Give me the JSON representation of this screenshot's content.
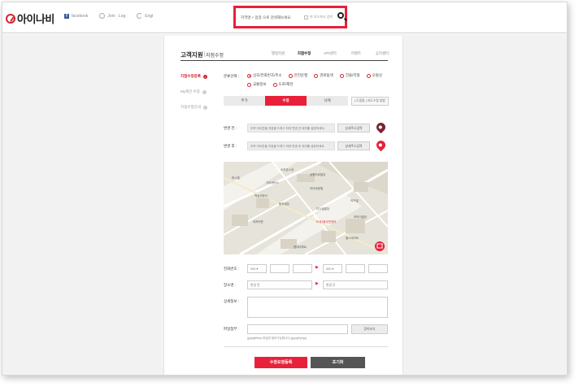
{
  "header": {
    "logo_text": "아이나비",
    "links": [
      {
        "label": "facebook"
      },
      {
        "label": "Join · Log"
      },
      {
        "label": "Engl"
      }
    ],
    "search": {
      "value": "지역명 + 업종 으로 검색해보세요",
      "option_label": "현 지도에서 검색"
    }
  },
  "page": {
    "title": "고객지원",
    "subtitle": "지점수정",
    "tabs": [
      "행정지원",
      "지점수정",
      "API센터",
      "이벤트",
      "공지센터"
    ],
    "active_tab": 1
  },
  "sidebar": {
    "items": [
      {
        "label": "지점수정등록",
        "active": true
      },
      {
        "label": "My제안 수정",
        "active": false
      },
      {
        "label": "지점수정안내",
        "active": false
      }
    ]
  },
  "form": {
    "category_label": "분류선택",
    "categories": [
      {
        "label": "상호/전화번호/주소",
        "checked": true
      },
      {
        "label": "안전운행",
        "checked": false
      },
      {
        "label": "경로탐색",
        "checked": false
      },
      {
        "label": "건물/지형",
        "checked": false
      },
      {
        "label": "오탈상",
        "checked": false
      },
      {
        "label": "교통정보",
        "checked": false
      },
      {
        "label": "도로/제한",
        "checked": false
      }
    ],
    "modes": [
      "추가",
      "수정",
      "삭제"
    ],
    "active_mode": 1,
    "mode_hint": "[ 도움말 ] 지도수정 방법",
    "before_label": "변경 전",
    "before_value": "우측 아이콘을 지정을 드래그 하여 변경 전 위치를 설정하세요.",
    "after_label": "변경 후",
    "after_value": "우측 아이콘을 지정을 드래그 하여 변경 후 위치를 설정하세요.",
    "addr_btn": "상세주소입력",
    "map_labels": [
      "오리온스센",
      "삼원타워빌딩",
      "가야센터스",
      "아이바호텔",
      "역삼부동산",
      "파스텔",
      "동부빌딩",
      "리츠빌",
      "디스빌빌딩",
      "도곡1동주민센터",
      "프라이빌딩",
      "대치타운",
      "현대아파트",
      "힐스테이트"
    ],
    "phone_label": "전화번호",
    "phone_prefix_before": "000",
    "phone_prefix_after": "000",
    "name_label": "장소명",
    "name_before": "변경 전",
    "name_after": "변경 후",
    "detail_label": "상세정보",
    "file_label": "파일첨부",
    "file_btn": "찾아보기",
    "file_hint": "(jpg/gif/bmp 파일만 첨부가능합니다 (jpg/gif/png))",
    "submit_label": "수정요청등록",
    "reset_label": "초기화"
  },
  "colors": {
    "accent": "#e8203a",
    "dark_btn": "#555555",
    "pin_before": "#7a2432",
    "pin_after": "#e8203a"
  }
}
